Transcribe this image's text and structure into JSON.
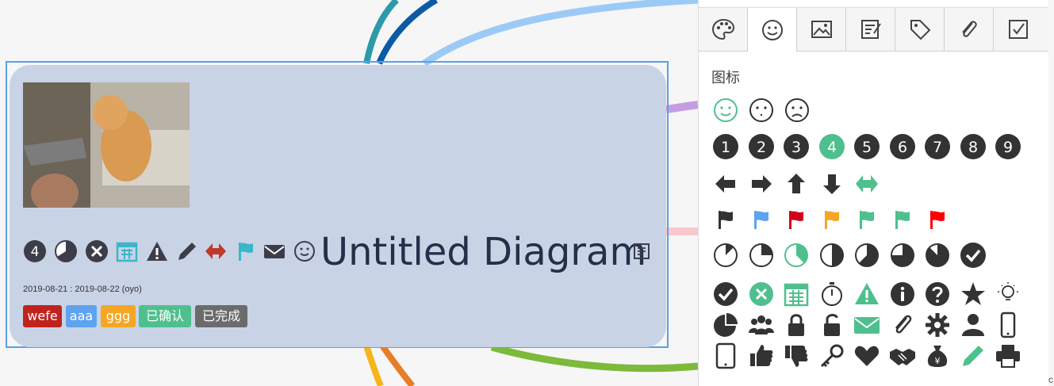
{
  "node": {
    "title": "Untitled Diagram",
    "dates": "2019-08-21 : 2019-08-22  (oyo)",
    "priority_number": "4",
    "tags": [
      {
        "label": "wefe",
        "color": "#c0231e"
      },
      {
        "label": "aaa",
        "color": "#5ea3f0"
      },
      {
        "label": "ggg",
        "color": "#f5a623"
      },
      {
        "label": "已确认",
        "color": "#4fc08d"
      },
      {
        "label": "已完成",
        "color": "#6b6b6b"
      }
    ]
  },
  "panel": {
    "tabs": [
      "palette-icon",
      "smiley-icon",
      "image-icon",
      "note-icon",
      "tag-icon",
      "link-icon",
      "checkbox-icon"
    ],
    "active_tab": 1,
    "section_title": "图标",
    "numbers": [
      "1",
      "2",
      "3",
      "4",
      "5",
      "6",
      "7",
      "8",
      "9"
    ],
    "selected_number": "4",
    "accent_color": "#4fc08d",
    "flag_colors": [
      "#333333",
      "#5ea3f0",
      "#d0021b",
      "#f5a623",
      "#4fc08d",
      "#4fc08d",
      "#ff0000"
    ]
  },
  "corner_text": "c"
}
